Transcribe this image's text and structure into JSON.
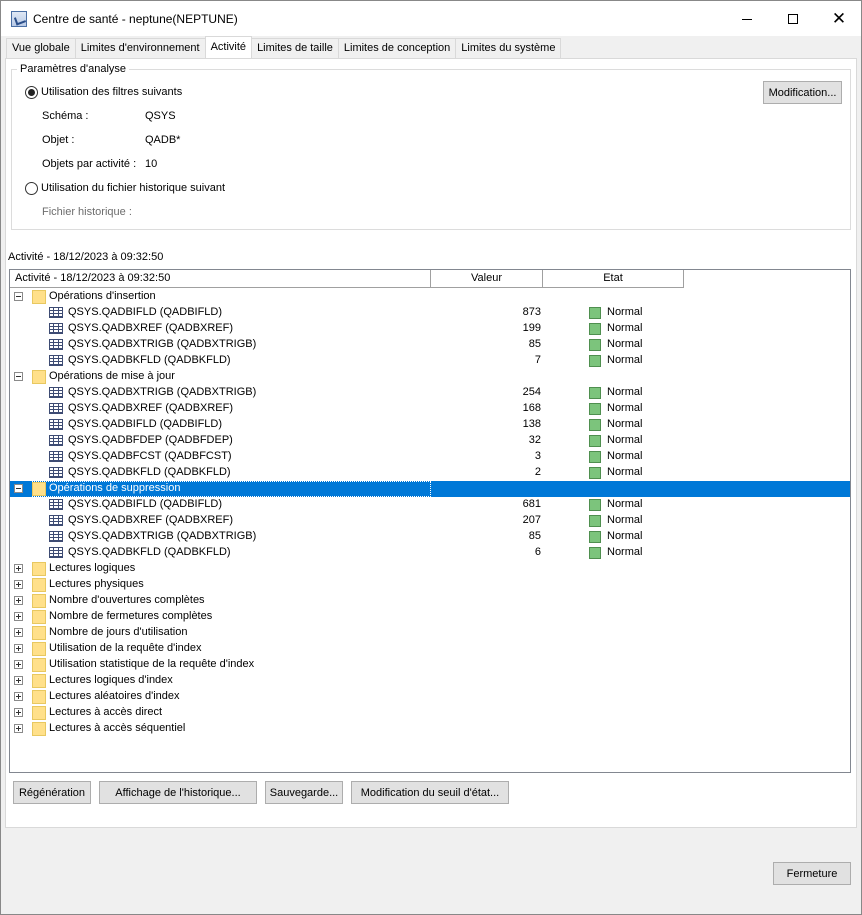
{
  "window": {
    "title": "Centre de santé - neptune(NEPTUNE)",
    "minimize": "minimize",
    "maximize": "maximize",
    "close": "✕"
  },
  "tabs": [
    {
      "label": "Vue globale",
      "active": false
    },
    {
      "label": "Limites d'environnement",
      "active": false
    },
    {
      "label": "Activité",
      "active": true
    },
    {
      "label": "Limites de taille",
      "active": false
    },
    {
      "label": "Limites de conception",
      "active": false
    },
    {
      "label": "Limites du système",
      "active": false
    }
  ],
  "analysis": {
    "legend": "Paramètres d'analyse",
    "filters_option": "Utilisation des filtres suivants",
    "schema_label": "Schéma :",
    "schema_value": "QSYS",
    "object_label": "Objet :",
    "object_value": "QADB*",
    "objects_per_activity_label": "Objets par activité :",
    "objects_per_activity_value": "10",
    "history_option": "Utilisation du fichier historique suivant",
    "history_file_label": "Fichier historique :",
    "modify_button": "Modification..."
  },
  "activity_title": "Activité - 18/12/2023 à 09:32:50",
  "tree": {
    "headers": {
      "name": "Activité - 18/12/2023 à 09:32:50",
      "value": "Valeur",
      "state": "Etat"
    },
    "rows": [
      {
        "kind": "group",
        "label": "Opérations d'insertion",
        "expanded": true
      },
      {
        "kind": "item",
        "label": "QSYS.QADBIFLD  (QADBIFLD)",
        "value": "873",
        "state": "Normal"
      },
      {
        "kind": "item",
        "label": "QSYS.QADBXREF  (QADBXREF)",
        "value": "199",
        "state": "Normal"
      },
      {
        "kind": "item",
        "label": "QSYS.QADBXTRIGB  (QADBXTRIGB)",
        "value": "85",
        "state": "Normal"
      },
      {
        "kind": "item",
        "label": "QSYS.QADBKFLD  (QADBKFLD)",
        "value": "7",
        "state": "Normal"
      },
      {
        "kind": "group",
        "label": "Opérations de mise à jour",
        "expanded": true
      },
      {
        "kind": "item",
        "label": "QSYS.QADBXTRIGB  (QADBXTRIGB)",
        "value": "254",
        "state": "Normal"
      },
      {
        "kind": "item",
        "label": "QSYS.QADBXREF  (QADBXREF)",
        "value": "168",
        "state": "Normal"
      },
      {
        "kind": "item",
        "label": "QSYS.QADBIFLD  (QADBIFLD)",
        "value": "138",
        "state": "Normal"
      },
      {
        "kind": "item",
        "label": "QSYS.QADBFDEP  (QADBFDEP)",
        "value": "32",
        "state": "Normal"
      },
      {
        "kind": "item",
        "label": "QSYS.QADBFCST  (QADBFCST)",
        "value": "3",
        "state": "Normal"
      },
      {
        "kind": "item",
        "label": "QSYS.QADBKFLD  (QADBKFLD)",
        "value": "2",
        "state": "Normal"
      },
      {
        "kind": "group",
        "label": "Opérations de suppression",
        "expanded": true,
        "selected": true
      },
      {
        "kind": "item",
        "label": "QSYS.QADBIFLD  (QADBIFLD)",
        "value": "681",
        "state": "Normal"
      },
      {
        "kind": "item",
        "label": "QSYS.QADBXREF  (QADBXREF)",
        "value": "207",
        "state": "Normal"
      },
      {
        "kind": "item",
        "label": "QSYS.QADBXTRIGB  (QADBXTRIGB)",
        "value": "85",
        "state": "Normal"
      },
      {
        "kind": "item",
        "label": "QSYS.QADBKFLD  (QADBKFLD)",
        "value": "6",
        "state": "Normal"
      },
      {
        "kind": "group",
        "label": "Lectures logiques",
        "expanded": false
      },
      {
        "kind": "group",
        "label": "Lectures physiques",
        "expanded": false
      },
      {
        "kind": "group",
        "label": "Nombre d'ouvertures complètes",
        "expanded": false
      },
      {
        "kind": "group",
        "label": "Nombre de fermetures complètes",
        "expanded": false
      },
      {
        "kind": "group",
        "label": "Nombre de jours d'utilisation",
        "expanded": false
      },
      {
        "kind": "group",
        "label": "Utilisation de la requête d'index",
        "expanded": false
      },
      {
        "kind": "group",
        "label": "Utilisation statistique de la requête d'index",
        "expanded": false
      },
      {
        "kind": "group",
        "label": "Lectures logiques d'index",
        "expanded": false
      },
      {
        "kind": "group",
        "label": "Lectures aléatoires d'index",
        "expanded": false
      },
      {
        "kind": "group",
        "label": "Lectures à accès direct",
        "expanded": false
      },
      {
        "kind": "group",
        "label": "Lectures à accès séquentiel",
        "expanded": false
      }
    ]
  },
  "buttons": {
    "regenerate": "Régénération",
    "history_display": "Affichage de l'historique...",
    "save": "Sauvegarde...",
    "modify_threshold": "Modification du seuil d'état...",
    "close": "Fermeture"
  },
  "colors": {
    "selection": "#0078d7",
    "status_normal": "#7cc47c",
    "folder": "#ffe08a"
  }
}
